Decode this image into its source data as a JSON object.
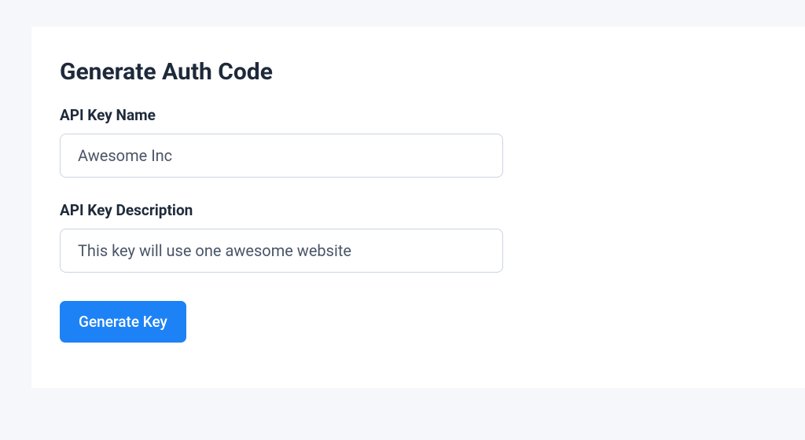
{
  "form": {
    "title": "Generate Auth Code",
    "name": {
      "label": "API Key Name",
      "value": "Awesome Inc"
    },
    "description": {
      "label": "API Key Description",
      "value": "This key will use one awesome website"
    },
    "submit_label": "Generate Key"
  }
}
